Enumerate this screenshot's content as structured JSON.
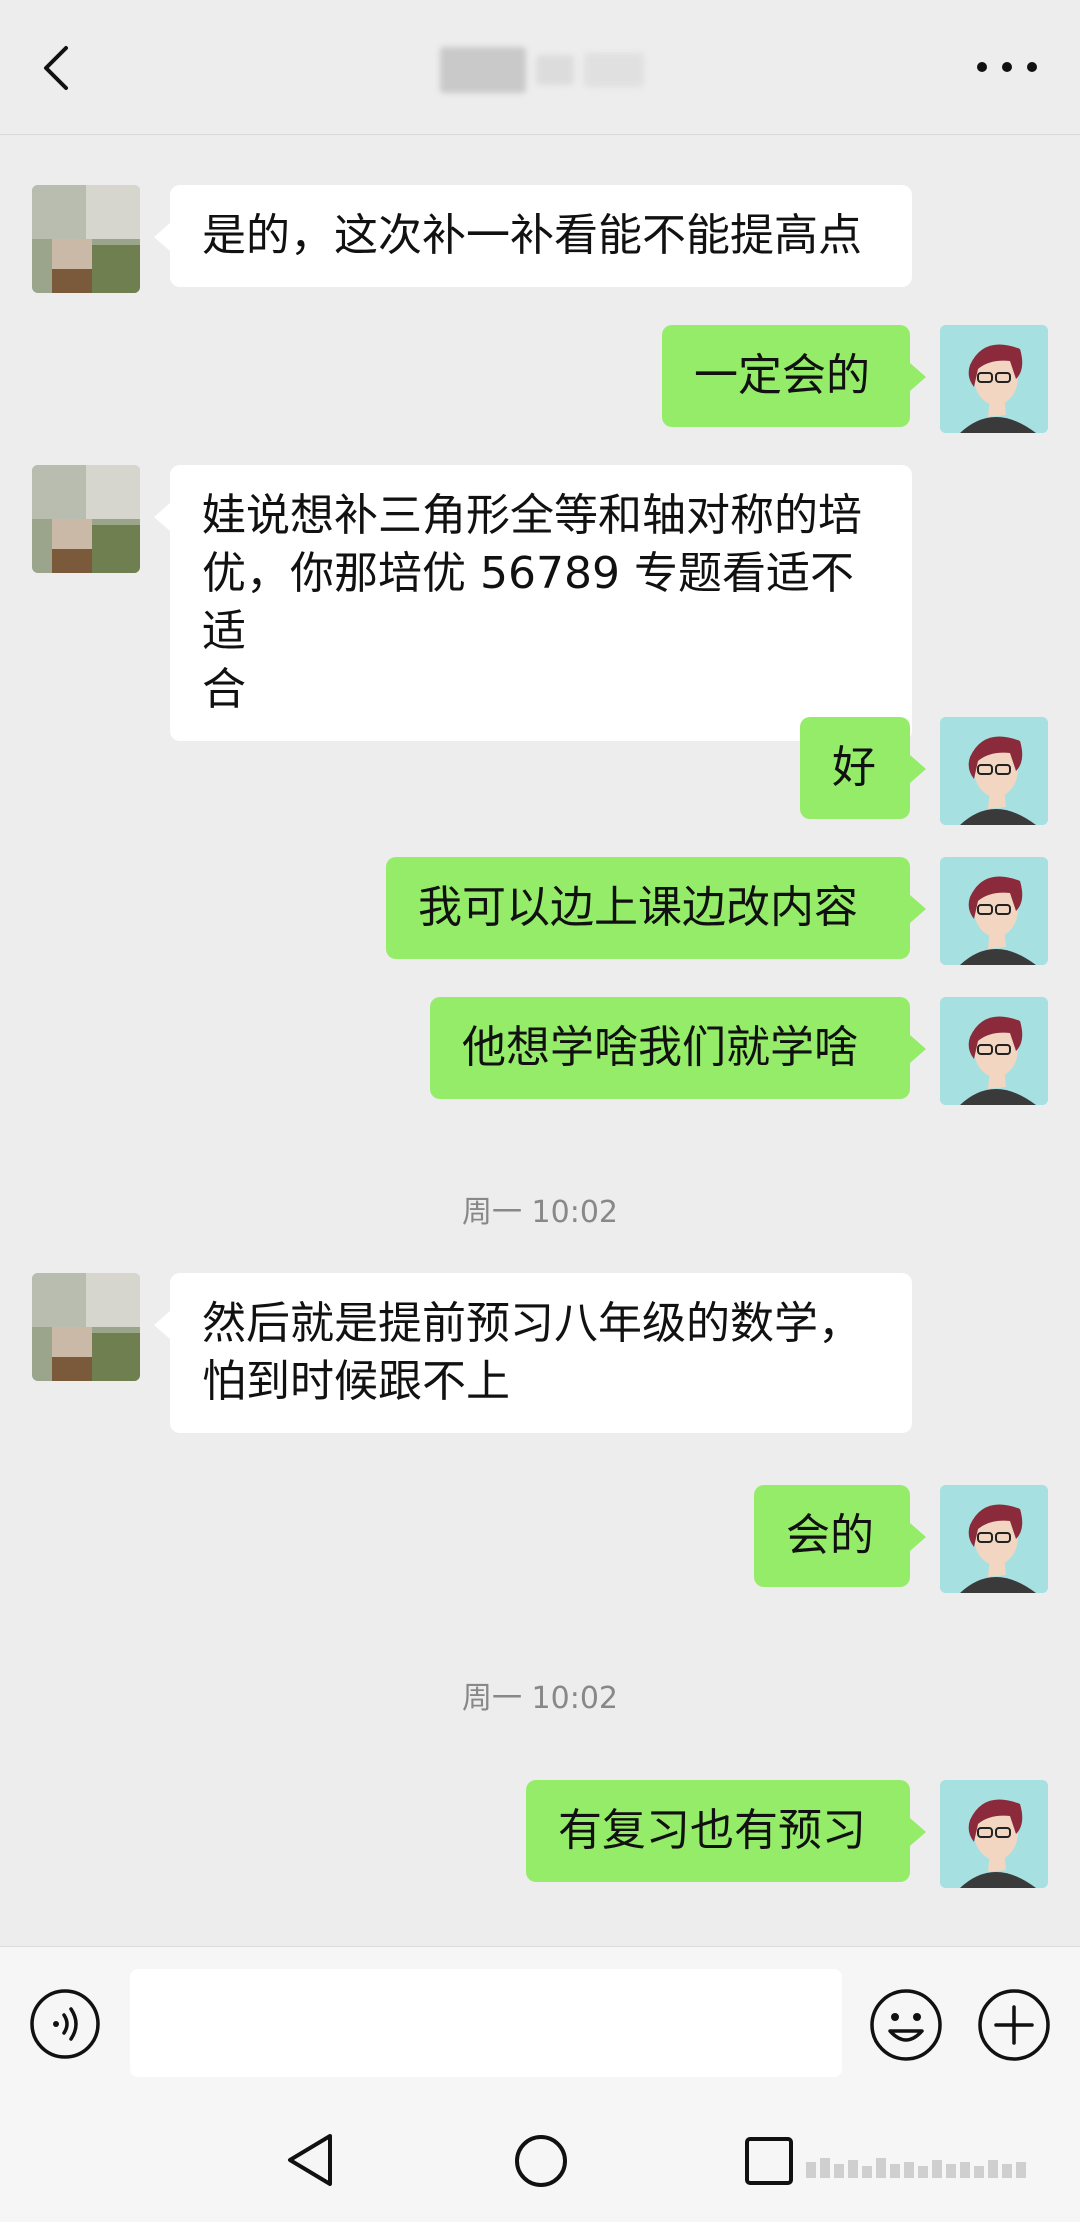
{
  "header": {
    "contact_name": "",
    "back_icon": "chevron-left-icon",
    "more_icon": "ellipsis-icon"
  },
  "messages": [
    {
      "side": "left",
      "text": "是的，这次补一补看能不能提高点"
    },
    {
      "side": "right",
      "text": "一定会的"
    },
    {
      "side": "left",
      "lines": [
        "娃说想补三角形全等和轴对称的培",
        "优，你那培优 56789 专题看适不适",
        "合"
      ]
    },
    {
      "side": "right",
      "text": "好"
    },
    {
      "side": "right",
      "text": "我可以边上课边改内容"
    },
    {
      "side": "right",
      "text": "他想学啥我们就学啥"
    },
    {
      "type": "timestamp",
      "text": "周一 10:02"
    },
    {
      "side": "left",
      "lines": [
        "然后就是提前预习八年级的数学，",
        "怕到时候跟不上"
      ]
    },
    {
      "side": "right",
      "text": "会的"
    },
    {
      "type": "timestamp",
      "text": "周一 10:02"
    },
    {
      "side": "right",
      "text": "有复习也有预习"
    }
  ],
  "input_bar": {
    "voice_icon": "voice-icon",
    "input_value": "",
    "emoji_icon": "emoji-icon",
    "plus_icon": "plus-icon"
  },
  "colors": {
    "background": "#ededed",
    "bubble_mine": "#95ec69",
    "bubble_other": "#ffffff"
  }
}
